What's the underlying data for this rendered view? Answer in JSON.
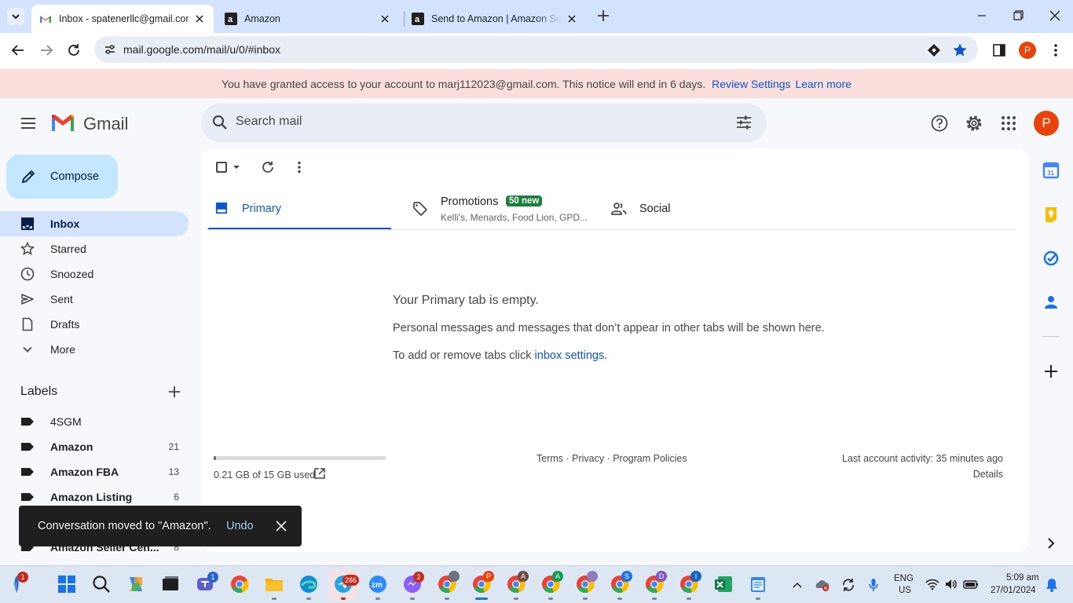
{
  "browser": {
    "tabs": [
      {
        "title": "Inbox - spatenerllc@gmail.com"
      },
      {
        "title": "Amazon"
      },
      {
        "title": "Send to Amazon | Amazon Seller"
      }
    ],
    "url": "mail.google.com/mail/u/0/#inbox",
    "profile_initial": "P"
  },
  "notice": {
    "text": "You have granted access to your account to marj112023@gmail.com. This notice will end in 6 days.",
    "review_link": "Review Settings",
    "learn_link": "Learn more"
  },
  "header": {
    "logo_text": "Gmail",
    "search_placeholder": "Search mail",
    "avatar_initial": "P"
  },
  "sidebar": {
    "compose_label": "Compose",
    "nav": [
      {
        "label": "Inbox"
      },
      {
        "label": "Starred"
      },
      {
        "label": "Snoozed"
      },
      {
        "label": "Sent"
      },
      {
        "label": "Drafts"
      },
      {
        "label": "More"
      }
    ],
    "labels_heading": "Labels",
    "labels": [
      {
        "label": "4SGM",
        "count": ""
      },
      {
        "label": "Amazon",
        "count": "21"
      },
      {
        "label": "Amazon FBA",
        "count": "13"
      },
      {
        "label": "Amazon Listing",
        "count": "6"
      },
      {
        "label": "Amazon Seller Cen...",
        "count": "8"
      }
    ]
  },
  "main": {
    "tabs": [
      {
        "label": "Primary",
        "sub": ""
      },
      {
        "label": "Promotions",
        "sub": "Kelli's, Menards, Food Lion, GPD...",
        "badge": "50 new"
      },
      {
        "label": "Social",
        "sub": ""
      }
    ],
    "empty_title": "Your Primary tab is empty.",
    "empty_desc": "Personal messages and messages that don’t appear in other tabs will be shown here.",
    "empty_settings_prefix": "To add or remove tabs click ",
    "empty_settings_link": "inbox settings",
    "empty_settings_suffix": ".",
    "storage_used": "0.21 GB of 15 GB used",
    "storage_fraction": 0.014,
    "footer_links": "Terms · Privacy · Program Policies",
    "last_activity": "Last account activity: 35 minutes ago",
    "details": "Details"
  },
  "snackbar": {
    "text": "Conversation moved to \"Amazon\".",
    "undo": "Undo"
  },
  "taskbar": {
    "notif_badge": "1",
    "teams_badge": "1",
    "telegram_badge": "286",
    "messenger_badge": "2",
    "chrome_badges": [
      "",
      "P",
      "A",
      "A",
      "",
      "S",
      "D",
      "I"
    ],
    "language": "ENG",
    "region": "US",
    "time": "5:09 am",
    "date": "27/01/2024"
  },
  "colors": {
    "accent_blue": "#0b57d0",
    "profile_orange": "#e8430a",
    "compose_bg": "#c2e7ff",
    "promo_badge": "#188038"
  }
}
